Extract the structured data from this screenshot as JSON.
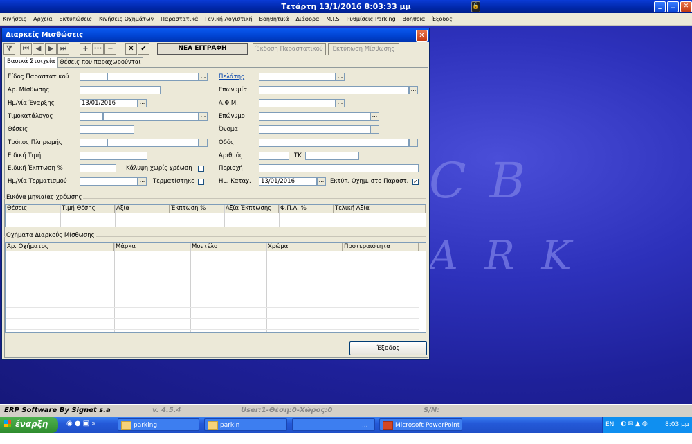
{
  "app": {
    "title": "Τετάρτη  13/1/2016 8:03:33 μμ"
  },
  "menu": [
    "Κινήσεις",
    "Αρχεία",
    "Εκτυπώσεις",
    "Κινήσεις Οχημάτων",
    "Παραστατικά",
    "Γενική Λογιστική",
    "Βοηθητικά",
    "Διάφορα",
    "M.I.S",
    "Ρυθμίσεις Parking",
    "Βοήθεια",
    "Έξοδος"
  ],
  "desktop": {
    "logo_line1": "C  B",
    "logo_line2": "A R K"
  },
  "dialog": {
    "title": "Διαρκείς Μισθώσεις",
    "toolbar": {
      "new_record": "ΝΕΑ ΕΓΓΡΑΦΗ",
      "issue_doc": "Έκδοση Παραστατικού",
      "print_lease": "Εκτύπωση Μίσθωσης"
    },
    "tabs": [
      "Βασικά Στοιχεία",
      "Θέσεις που παραχωρούνται"
    ],
    "left": {
      "doc_type": "Είδος Παραστατικού",
      "lease_no": "Αρ. Μίσθωσης",
      "start_date": "Ημ/νία Έναρξης",
      "start_date_value": "13/01/2016",
      "price_list": "Τιμοκατάλογος",
      "positions": "Θέσεις",
      "payment": "Τρόπος Πληρωμής",
      "special_price": "Ειδική Τιμή",
      "special_discount": "Ειδική Έκπτωση %",
      "coverage_no_charge": "Κάλυψη χωρίς χρέωση",
      "end_date": "Ημ/νία Τερματισμού",
      "terminated": "Τερματίστηκε"
    },
    "right": {
      "customer": "Πελάτης",
      "name": "Επωνυμία",
      "vat": "Α.Φ.Μ.",
      "surname": "Επώνυμο",
      "firstname": "Όνομα",
      "street": "Οδός",
      "number": "Αριθμός",
      "postcode": "ΤΚ",
      "area": "Περιοχή",
      "reg_date": "Ημ. Καταχ.",
      "reg_date_value": "13/01/2016",
      "print_vehicles": "Εκτύπ. Οχημ. στο Παραστ."
    },
    "monthly": {
      "group": "Εικόνα μηνιαίας χρέωσης",
      "columns": [
        "Θέσεις",
        "Τιμή Θέσης",
        "Αξία",
        "Έκπτωση %",
        "Αξία Έκπτωσης",
        "Φ.Π.Α. %",
        "Τελική Αξία"
      ]
    },
    "vehicles": {
      "group": "Οχήματα Διαρκούς Μίσθωσης",
      "columns": [
        "Αρ. Οχήματος",
        "Μάρκα",
        "Μοντέλο",
        "Χρώμα",
        "Προτεραιότητα"
      ]
    },
    "exit": "Έξοδος"
  },
  "statusbar": {
    "company": "ERP Software By Signet s.a",
    "version": "v. 4.5.4",
    "user": "User:1-Θέση:0-Χώρος:0",
    "sn": "S/N:"
  },
  "taskbar": {
    "start": "έναρξη",
    "items": [
      "parking",
      "parkin",
      "...",
      "Microsoft PowerPoint ..."
    ],
    "lang": "EN",
    "time": "8:03 μμ"
  }
}
